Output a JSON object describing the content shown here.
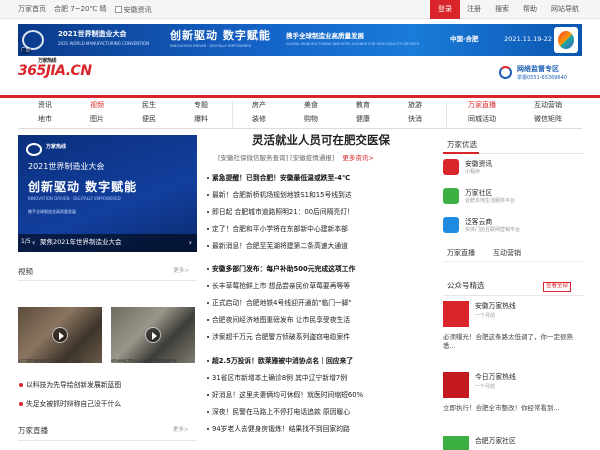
{
  "topbar": {
    "home": "万家首页",
    "city": "合肥",
    "weather": "7~20℃ 晴",
    "anhui_news": "安徽资讯",
    "login": "登录",
    "register": "注册",
    "search": "搜索",
    "help": "帮助",
    "site_nav": "网站导航"
  },
  "banner": {
    "expo_title": "2021世界制造业大会",
    "expo_en": "2021 WORLD MANUFACTURING CONVENTION",
    "slogan": "创新驱动 数字赋能",
    "slogan_en": "INNOVATION DRIVEN · DIGITALLY EMPOWERED",
    "theme": "携手全球制造业高质量发展",
    "theme_en": "GLOBAL MANUFACTURING INDUSTRY ALIGNED FOR HIGH-QUALITY GROWTH",
    "place": "中国·合肥",
    "date": "2021.11.19-22",
    "ad_tag": "广告"
  },
  "header": {
    "logo_text": "365JIA.CN",
    "logo_sub": "万家热线",
    "supervise_title": "网络监督专区",
    "supervise_phone": "举报0551-65369640"
  },
  "nav": {
    "col1": [
      "资讯",
      "地市"
    ],
    "col2": [
      "视频",
      "图片"
    ],
    "col3": [
      "民生",
      "便民"
    ],
    "col4": [
      "专题",
      "爆料"
    ],
    "col5": [
      "房产",
      "装修"
    ],
    "col6": [
      "美食",
      "购物"
    ],
    "col7": [
      "教育",
      "健康"
    ],
    "col8": [
      "旅游",
      "快消"
    ],
    "col9": [
      "万家直播",
      "同城活动"
    ],
    "col10": [
      "互动营销",
      "微信矩阵"
    ]
  },
  "hero": {
    "logo_text": "万家热线",
    "line1": "2021世界制造业大会",
    "line2": "创新驱动 数字赋能",
    "line3": "INNOVATION DRIVEN · DIGITALLY EMPOWERED",
    "line4": "携手全球制造业高质量发展",
    "cap_num": "1/5",
    "caption": "聚焦2021年世界制造业大会"
  },
  "headline": {
    "title": "灵活就业人员可在肥交医保",
    "link1": "[安徽社保微信服务查询]",
    "link2": "[安徽疫情通报]",
    "more": "更多资讯>"
  },
  "news1": [
    "紧急提醒！已到合肥！安徽最低温或跌至-4℃",
    "最新！合肥新桥机场规划地铁S1和15号线到达",
    "即日起 合肥城市道路照明21：00后间隔亮灯！",
    "定了！合肥和平小学将在东部新中心建新本部",
    "最新消息！合肥至芜湖将建第二条高速大通道"
  ],
  "news2": [
    "安徽多部门发布：每户补助500元完成这项工作",
    "长丰草莓抢鲜上市 想品尝亲民价草莓要再等等",
    "正式启动！合肥地铁4号线迎开通前\"临门一脚\"",
    "合肥夜间经济地图重磅发布 让市民享受夜生活",
    "涉案超千万元 合肥警方侦破系列盗窃电缆案件"
  ],
  "news3": [
    "超2.5万投诉！欧莱雅被中消协点名｜回应来了",
    "31省区市新增本土确诊8例 其中辽宁新增7例",
    "好消息！这里夫妻俩均可休假！就医时间缩短60%",
    "深夜！民警在马路上不停打电话追款 原因暖心",
    "94岁老人去健身房锻炼！结果找不到回家的路"
  ],
  "right": {
    "title": "万家优选",
    "apps": [
      {
        "name": "安徽资讯",
        "sub": "小程序"
      },
      {
        "name": "万家社区",
        "sub": "合肥本地生活服务平台"
      },
      {
        "name": "泛客云商",
        "sub": "实体门店互联网营销平台"
      }
    ],
    "tab1": "万家直播",
    "tab2": "互动营销"
  },
  "video": {
    "title": "视频",
    "more": "更多>",
    "cap1": "2只野猪闯入小区楼冲直播",
    "cap2": "眼镜蛇闯入工地消防员破殃"
  },
  "dotlist": [
    "以科技为先导绘创新发展新蓝图",
    "失足女被抓时辩称自己没干什么"
  ],
  "live": {
    "title": "万家直播",
    "more": "更多>"
  },
  "gzh": {
    "title": "公众号精选",
    "more_btn": "查看全部",
    "items": [
      {
        "name": "安徽万家热线",
        "date": "一个月前",
        "desc": "必须曝光！合肥这条路太低调了，你一定很熟悉..."
      },
      {
        "name": "今日万家热线",
        "date": "一个月前",
        "desc": "立即执行！合肥全市整改！你经常看到..."
      },
      {
        "name": "合肥万家社区",
        "date": "",
        "desc": ""
      }
    ]
  },
  "colors": {
    "brand_red": "#d9252a",
    "banner_blue": "#1565c9"
  }
}
